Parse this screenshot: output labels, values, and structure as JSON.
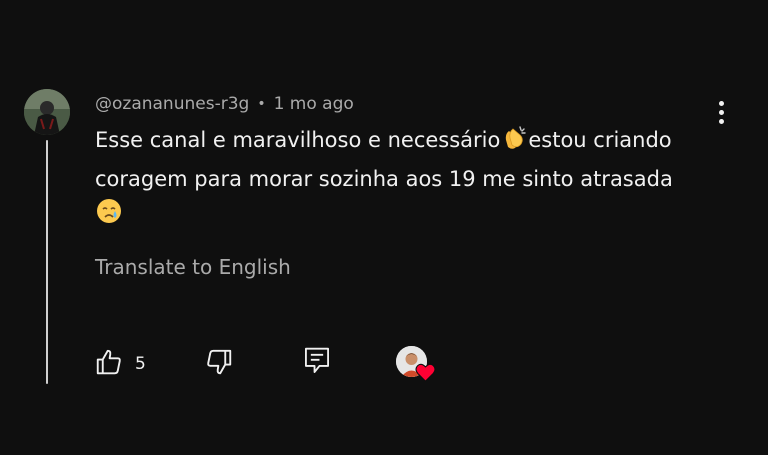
{
  "comment": {
    "author": "@ozananunes-r3g",
    "separator": "•",
    "timestamp": "1 mo ago",
    "text_part1": "Esse canal e maravilhoso e necessário",
    "emoji_clap": "clapping-hands-emoji",
    "text_part2": "estou criando coragem para morar sozinha aos 19 me sinto atrasada",
    "emoji_cry": "crying-face-emoji",
    "translate_label": "Translate to English",
    "like_count": "5"
  },
  "icons": {
    "more": "more-vert-icon",
    "like": "thumb-up-icon",
    "dislike": "thumb-down-icon",
    "reply": "reply-comment-icon",
    "heart": "heart-icon"
  },
  "colors": {
    "background": "#0f0f0f",
    "text": "#f1f1f1",
    "secondary_text": "#aaaaaa",
    "heart": "#ff0033"
  }
}
